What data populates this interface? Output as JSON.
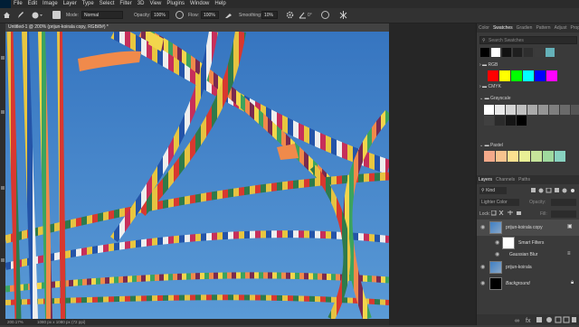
{
  "menubar": {
    "items": [
      "File",
      "Edit",
      "Image",
      "Layer",
      "Type",
      "Select",
      "Filter",
      "3D",
      "View",
      "Plugins",
      "Window",
      "Help"
    ]
  },
  "options": {
    "mode_label": "Mode:",
    "mode_value": "Normal",
    "opacity_label": "Opacity:",
    "opacity_value": "100%",
    "flow_label": "Flow:",
    "flow_value": "100%",
    "smoothing_label": "Smoothing:",
    "smoothing_value": "10%",
    "angle_value": "0°"
  },
  "document": {
    "tab_title": "Untitled-1 @ 200% (prijun-koirala copy, RGB/8#) *",
    "zoom": "200.17%",
    "doc_info": "1080 px x 1080 px (72 ppi)"
  },
  "swatches_panel": {
    "tabs": [
      "Color",
      "Swatches",
      "Gradien",
      "Pattern",
      "Adjust",
      "Propert"
    ],
    "search_placeholder": "Search Swatches",
    "groups": [
      "RGB",
      "CMYK",
      "Grayscale",
      "Pastel"
    ],
    "top_colors": [
      "#000000",
      "#ffffff",
      "#111111",
      "#1f1f1f",
      "#2e2e2e",
      "#3b3b3b",
      "#65b1b9"
    ],
    "rgb_colors": [
      "#ff0000",
      "#ffff00",
      "#00ff00",
      "#00ffff",
      "#0000ff",
      "#ff00ff"
    ],
    "grayscale": [
      "#ffffff",
      "#eaeaea",
      "#d4d4d4",
      "#bfbfbf",
      "#aaaaaa",
      "#959595",
      "#7f7f7f",
      "#6a6a6a",
      "#555555",
      "#404040",
      "#2b2b2b",
      "#151515",
      "#000000"
    ],
    "pastel": [
      "#f4a98a",
      "#f8c38e",
      "#fbe08f",
      "#e9ef95",
      "#c6e49a",
      "#9fd99e",
      "#88d2c0"
    ]
  },
  "layers_panel": {
    "tabs": [
      "Layers",
      "Channels",
      "Paths"
    ],
    "kind_label": "Kind",
    "blend_mode": "Lighter Color",
    "opacity_label": "Opacity:",
    "lock_label": "Lock:",
    "fill_label": "Fill:",
    "layers": [
      {
        "name": "prijun-koirala copy",
        "type": "smart"
      },
      {
        "name": "Smart Filters",
        "type": "filter-mask"
      },
      {
        "name": "Gaussian Blur",
        "type": "filter"
      },
      {
        "name": "prijun-koirala",
        "type": "image"
      },
      {
        "name": "Background",
        "type": "background"
      }
    ]
  },
  "colors": {
    "sky": "#3e7fc4",
    "panel": "#3a3a3a",
    "chrome": "#2b2b2b"
  },
  "icons": [
    "photoshop-logo-icon",
    "home-icon",
    "brush-tool-icon",
    "airbrush-icon",
    "gear-icon",
    "symmetry-icon",
    "eye-icon",
    "lock-icon",
    "trash-icon",
    "new-layer-icon",
    "chain-link-icon"
  ]
}
